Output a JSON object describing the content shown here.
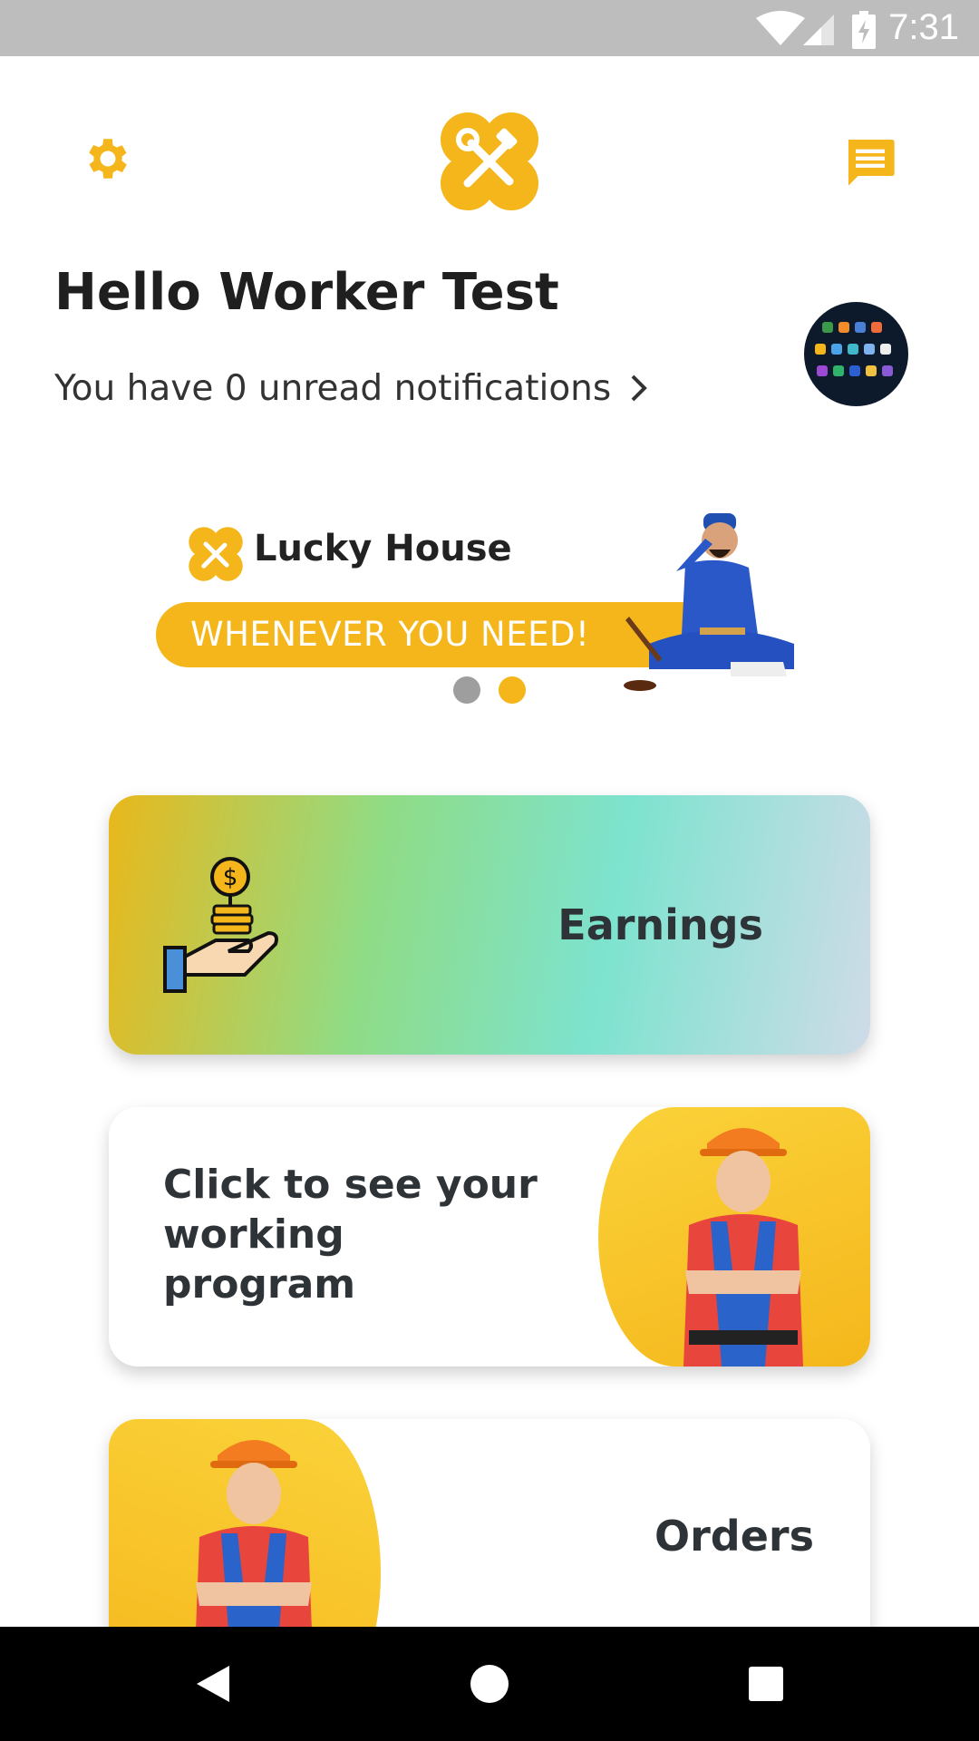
{
  "status_bar": {
    "time": "7:31"
  },
  "header": {
    "greeting": "Hello Worker Test",
    "notifications_text": "You have 0 unread notifications"
  },
  "banner": {
    "brand": "Lucky House",
    "tagline": "WHENEVER YOU NEED!",
    "active_slide": 2,
    "slide_count": 2
  },
  "cards": {
    "earnings": {
      "label": "Earnings"
    },
    "program": {
      "label": "Click to see your working program"
    },
    "orders": {
      "label": "Orders"
    }
  },
  "colors": {
    "accent": "#f4b61a",
    "text_dark": "#1f1f1f",
    "status_bar": "#bdbdbd"
  },
  "icons": [
    "settings-gear-icon",
    "app-logo-icon",
    "chat-message-icon",
    "chevron-right-icon",
    "coin-hand-icon",
    "back-icon",
    "home-icon",
    "recents-icon"
  ]
}
